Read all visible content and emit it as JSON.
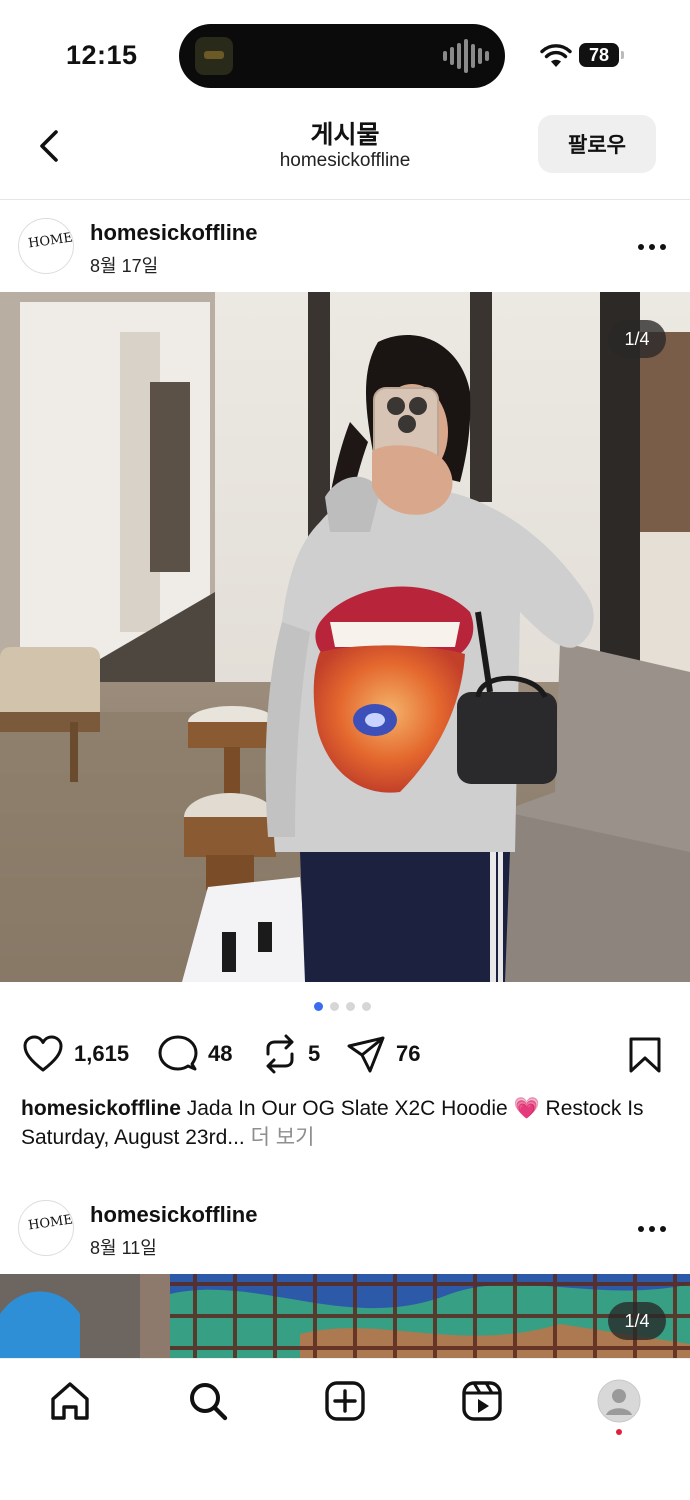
{
  "status_bar": {
    "time": "12:15",
    "battery": "78",
    "icons": [
      "wifi-icon",
      "battery-icon"
    ]
  },
  "header": {
    "title": "게시물",
    "subtitle": "homesickoffline",
    "follow_label": "팔로우",
    "back_icon": "chevron-left-icon"
  },
  "posts": [
    {
      "username": "homesickoffline",
      "date": "8월 17일",
      "avatar_text": "HOME SICK",
      "image_counter": "1/4",
      "carousel_dots": 4,
      "carousel_active": 0,
      "likes": "1,615",
      "comments": "48",
      "reposts": "5",
      "shares": "76",
      "caption_user": "homesickoffline",
      "caption_text": " Jada In Our OG Slate X2C Hoodie 💗 Restock Is Saturday, August 23rd...",
      "caption_more": " 더 보기"
    },
    {
      "username": "homesickoffline",
      "date": "8월 11일",
      "avatar_text": "HOME SICK",
      "image_counter": "1/4"
    }
  ],
  "bottom_nav": {
    "items": [
      "home-icon",
      "search-icon",
      "create-icon",
      "reels-icon",
      "profile-avatar"
    ]
  },
  "colors": {
    "accent_dot": "#3b6cf0",
    "notification_dot": "#e0213e",
    "follow_button_bg": "#efefef"
  }
}
